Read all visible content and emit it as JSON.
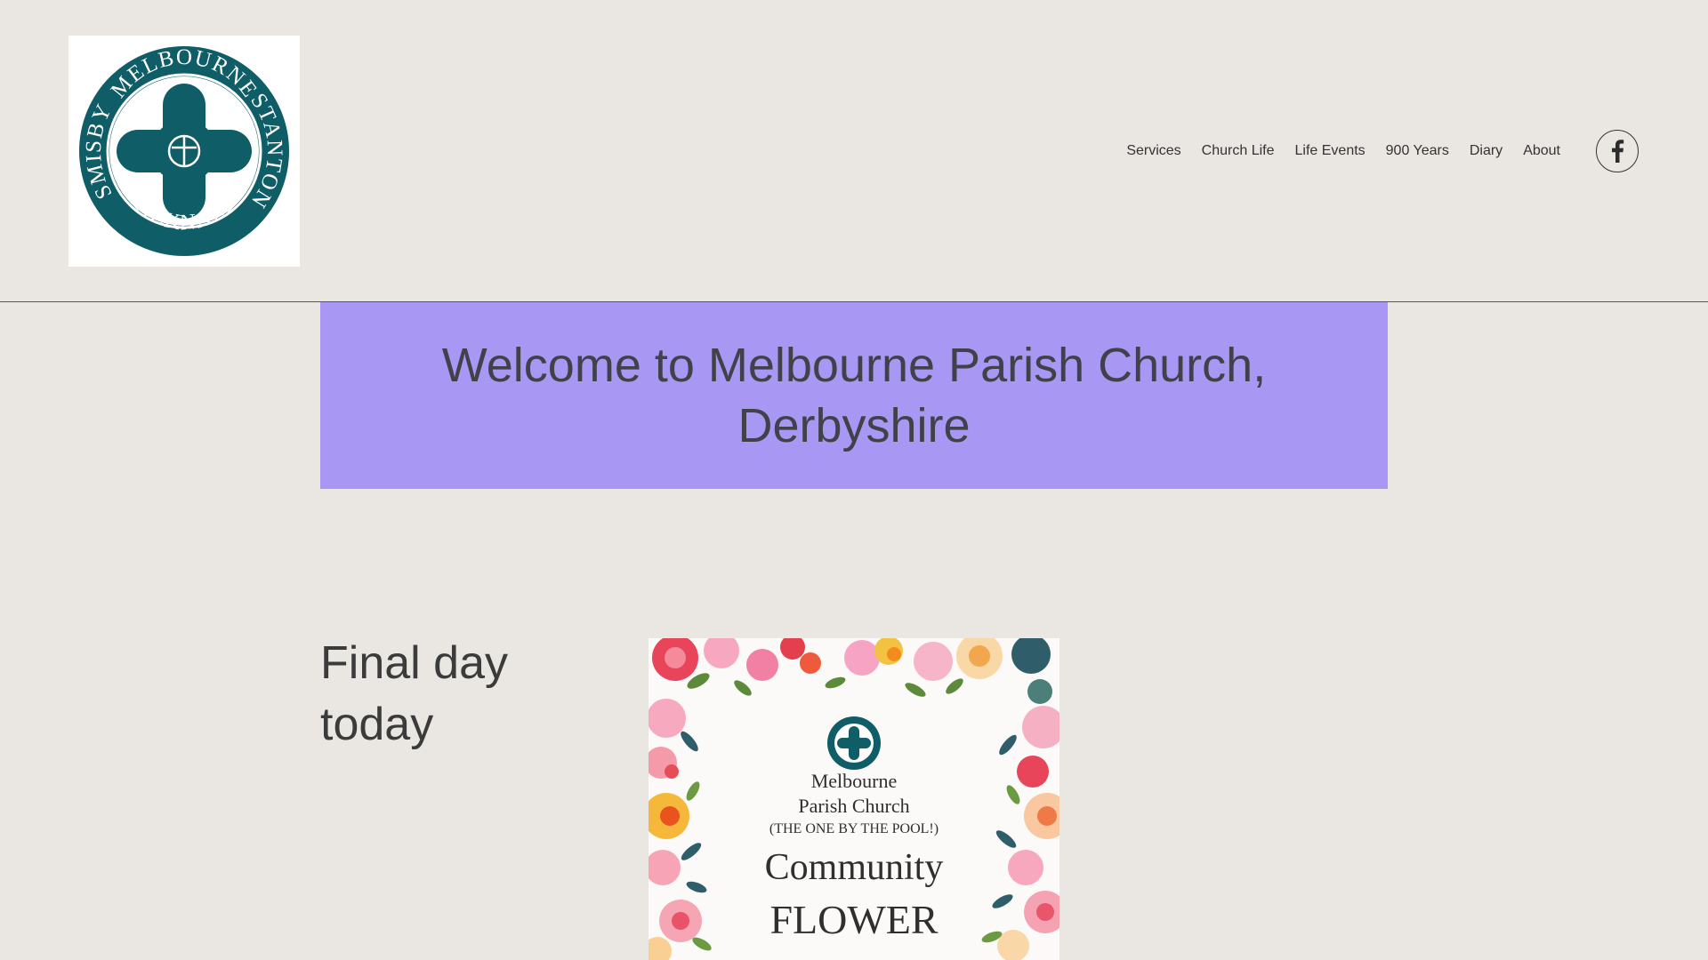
{
  "header": {
    "logo": {
      "ring_top": "MELBOURNE",
      "ring_right": "STANTON",
      "ring_bottom": "TICKNALL",
      "ring_left": "SMISBY",
      "color": "#0f5d66"
    },
    "nav": [
      {
        "label": "Services"
      },
      {
        "label": "Church Life"
      },
      {
        "label": "Life Events"
      },
      {
        "label": "900 Years"
      },
      {
        "label": "Diary"
      },
      {
        "label": "About"
      }
    ],
    "social": {
      "icon": "facebook-icon"
    }
  },
  "banner": {
    "title": "Welcome to Melbourne Parish Church, Derbyshire",
    "background": "#a898f4"
  },
  "post": {
    "title": "Final day today",
    "poster": {
      "line1": "Melbourne",
      "line2": "Parish Church",
      "line3": "(THE ONE BY THE POOL!)",
      "line4": "Community",
      "line5": "FLOWER"
    }
  },
  "colors": {
    "page_background": "#eae7e2",
    "text": "#3b3b3b",
    "logo_teal": "#0f5d66"
  }
}
